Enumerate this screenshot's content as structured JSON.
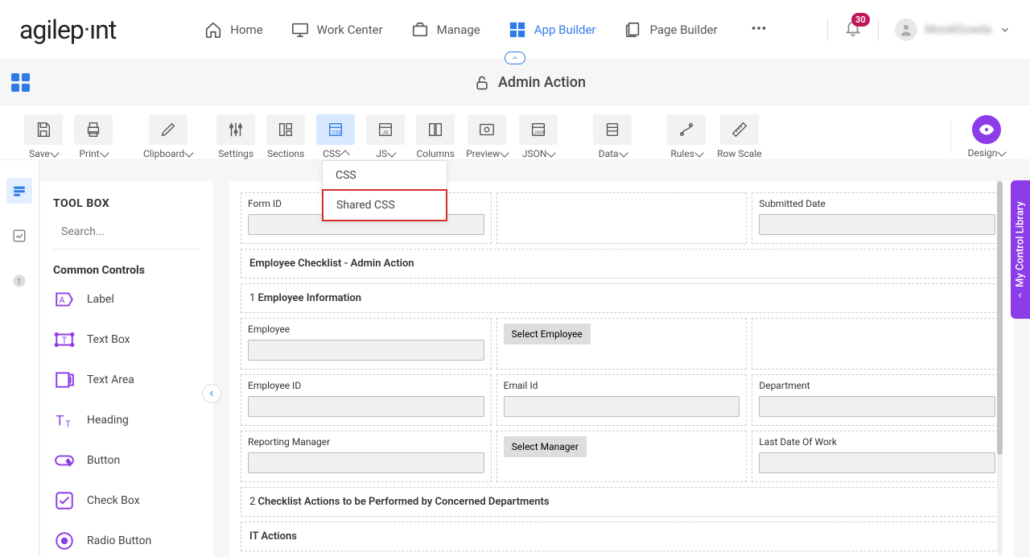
{
  "nav": {
    "home": "Home",
    "wc": "Work Center",
    "manage": "Manage",
    "ab": "App Builder",
    "pb": "Page Builder"
  },
  "notif_count": "30",
  "username": "MuraliGowda",
  "page_title": "Admin Action",
  "toolbar": {
    "save": "Save",
    "print": "Print",
    "clipboard": "Clipboard",
    "settings": "Settings",
    "sections": "Sections",
    "css": "CSS",
    "js": "JS",
    "columns": "Columns",
    "preview": "Preview",
    "json": "JSON",
    "data": "Data",
    "rules": "Rules",
    "rowscale": "Row Scale",
    "design": "Design"
  },
  "css_menu": {
    "css": "CSS",
    "shared": "Shared CSS"
  },
  "toolbox": {
    "title": "TOOL BOX",
    "search_ph": "Search...",
    "cat": "Common Controls",
    "items": [
      "Label",
      "Text Box",
      "Text Area",
      "Heading",
      "Button",
      "Check Box",
      "Radio Button"
    ]
  },
  "form": {
    "form_id": "Form ID",
    "submitted": "Submitted Date",
    "sec_checklist": "Employee Checklist - Admin Action",
    "sec_emp_num": "1",
    "sec_emp": "Employee Information",
    "employee": "Employee",
    "select_emp": "Select Employee",
    "emp_id": "Employee ID",
    "email": "Email Id",
    "dept": "Department",
    "rep_mgr": "Reporting Manager",
    "select_mgr": "Select Manager",
    "last_date": "Last Date Of Work",
    "sec_check_num": "2",
    "sec_check": "Checklist Actions to be Performed by Concerned Departments",
    "it_actions": "IT Actions"
  },
  "lib_label": "My Control Library"
}
